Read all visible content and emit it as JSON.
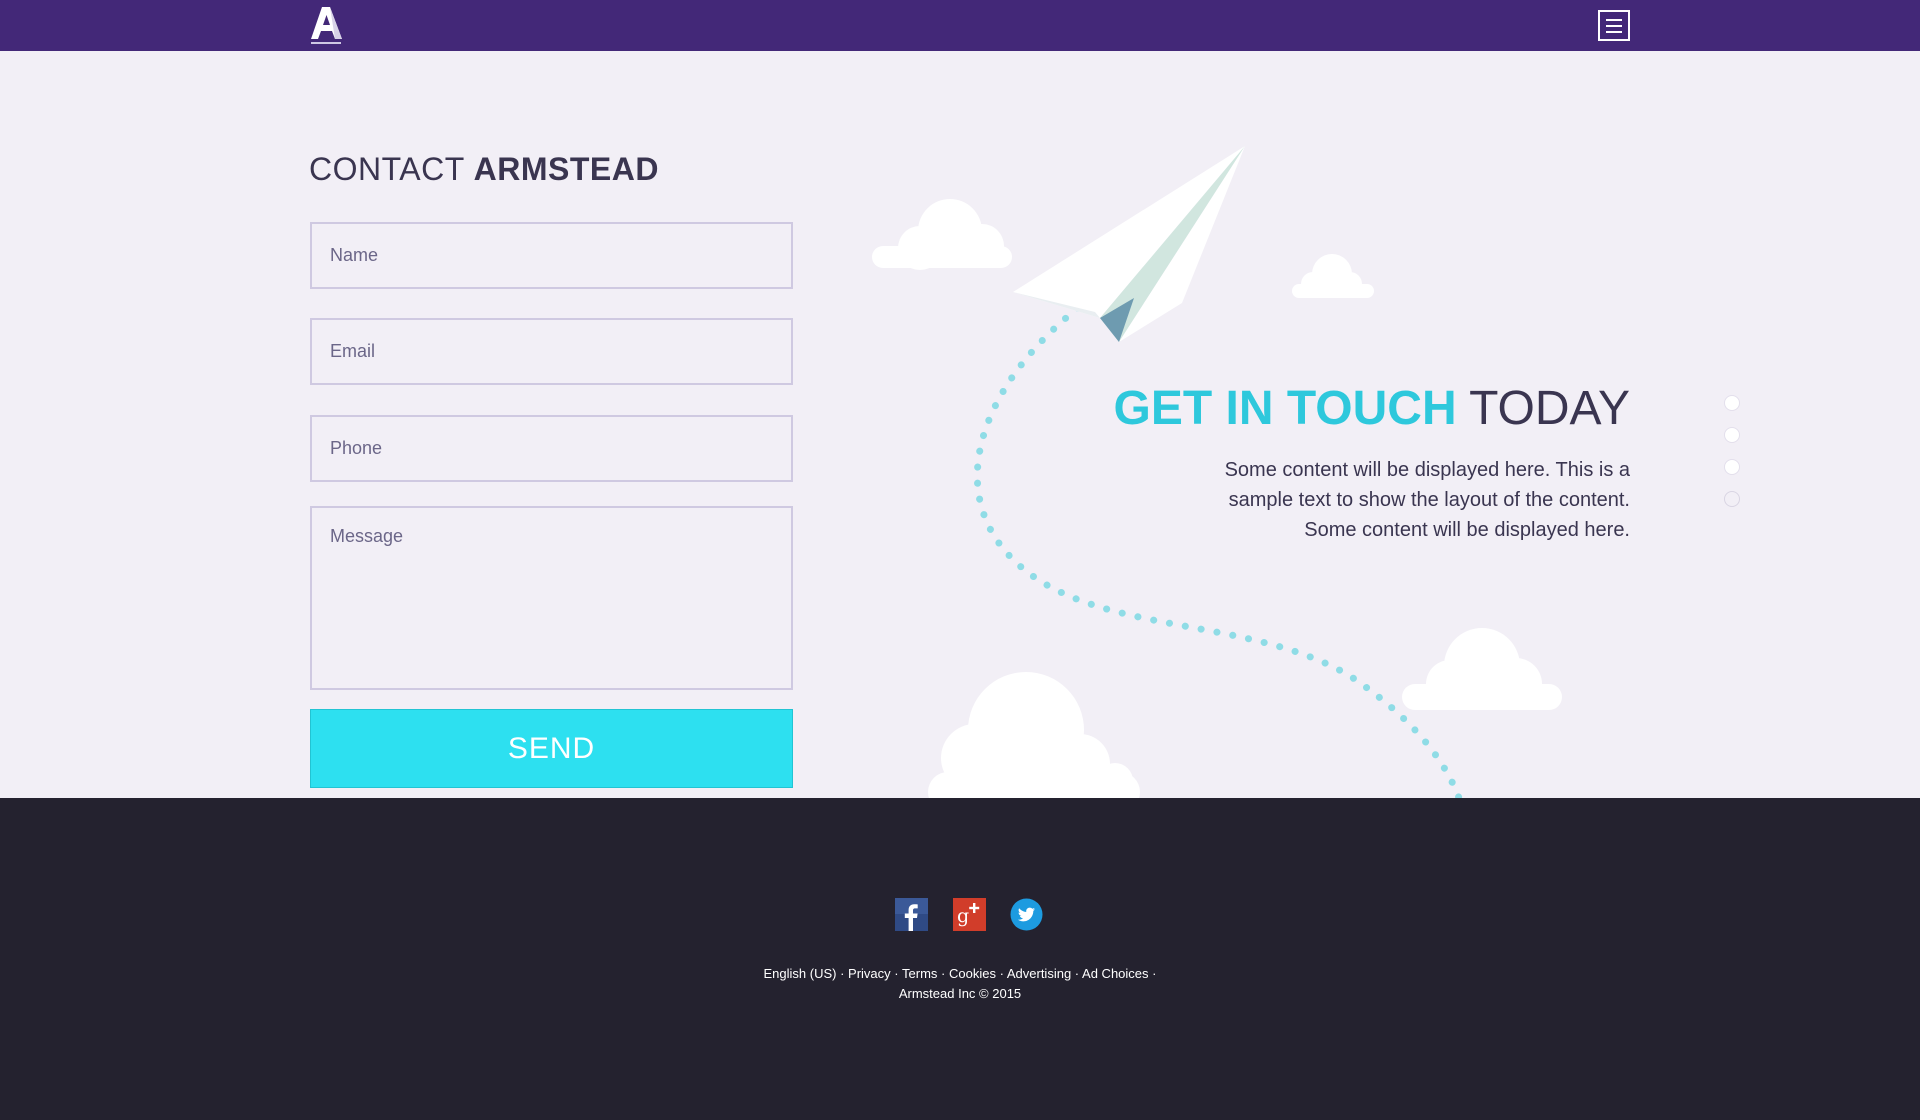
{
  "header": {
    "logo_alt": "Armstead logo",
    "menu_icon": "hamburger-menu-icon"
  },
  "contact": {
    "title_light": "CONTACT",
    "title_bold": "ARMSTEAD",
    "name_placeholder": "Name",
    "email_placeholder": "Email",
    "phone_placeholder": "Phone",
    "message_placeholder": "Message",
    "send_label": "SEND"
  },
  "hero": {
    "title_accent": "GET IN TOUCH",
    "title_rest": "TODAY",
    "body_line1": "Some content will be displayed here. This is a",
    "body_line2": "sample text to show the layout of the content.",
    "body_line3": "Some content will be displayed here."
  },
  "pager": {
    "count": 4,
    "active_index": 3
  },
  "footer": {
    "social": [
      "facebook-icon",
      "google-plus-icon",
      "twitter-icon"
    ],
    "links": [
      "English (US)",
      "Privacy",
      "Terms",
      "Cookies",
      "Advertising",
      "Ad Choices"
    ],
    "separator": "·",
    "copyright": "Armstead Inc © 2015"
  },
  "colors": {
    "header_bg": "#432878",
    "page_bg": "#f2eff6",
    "accent": "#2ec8dc",
    "send_bg": "#2de0f0",
    "footer_bg": "#24222f",
    "text_dark": "#3a3550"
  }
}
